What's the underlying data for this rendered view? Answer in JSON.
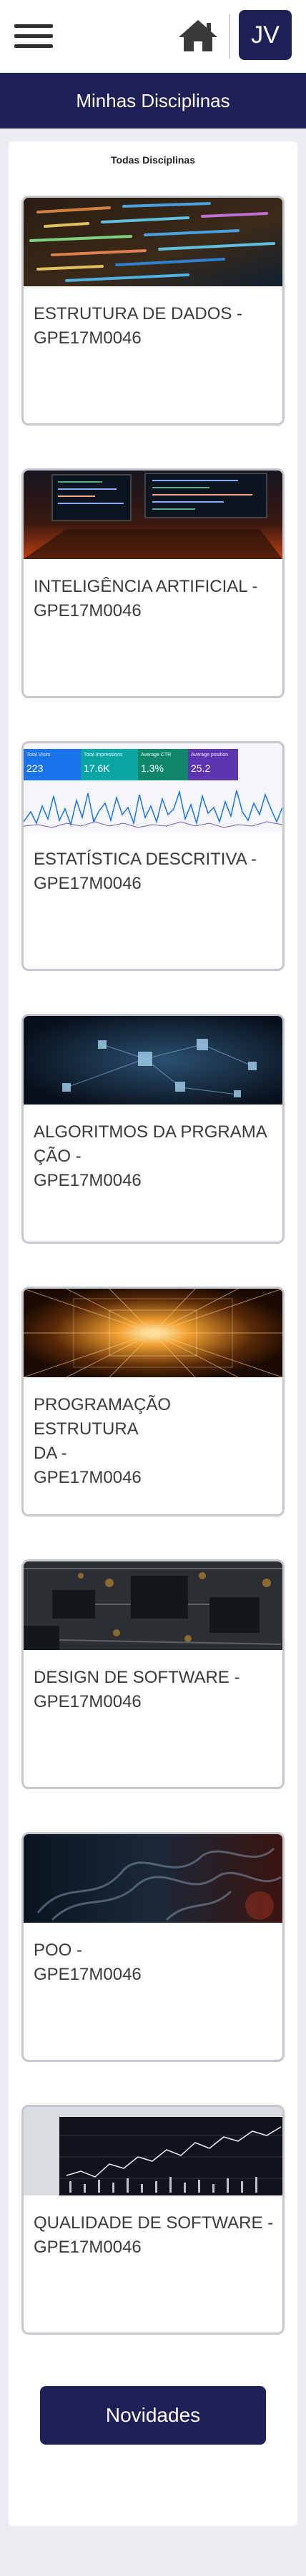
{
  "header": {
    "menu_icon": "hamburger-menu-icon",
    "home_icon": "home-icon",
    "avatar_initials": "JV"
  },
  "page": {
    "title": "Minhas Disciplinas",
    "section_title": "Todas Disciplinas"
  },
  "courses": [
    {
      "title": "ESTRUTURA DE DADOS -\nGPE17M0046",
      "image": "code-screen-image"
    },
    {
      "title": "INTELIGÊNCIA ARTIFICIAL -\nGPE17M0046",
      "image": "laptop-code-image"
    },
    {
      "title": "ESTATÍSTICA DESCRITIVA -\nGPE17M0046",
      "image": "analytics-dashboard-image",
      "image_stats": [
        {
          "label": "Total Visits",
          "value": "223"
        },
        {
          "label": "Total Impressions",
          "value": "17.6K"
        },
        {
          "label": "Average CTR",
          "value": "1.3%"
        },
        {
          "label": "Average position",
          "value": "25.2"
        }
      ]
    },
    {
      "title": "ALGORITMOS DA PRGRAMA\nÇÃO -\nGPE17M0046",
      "image": "network-cubes-image"
    },
    {
      "title": "PROGRAMAÇÃO ESTRUTURA\nDA -\nGPE17M0046",
      "image": "data-tunnel-image"
    },
    {
      "title": "DESIGN DE SOFTWARE -\nGPE17M0046",
      "image": "circuit-board-image"
    },
    {
      "title": "POO -\nGPE17M0046",
      "image": "smoke-dark-image"
    },
    {
      "title": "QUALIDADE DE SOFTWARE -\nGPE17M0046",
      "image": "stock-chart-image"
    }
  ],
  "footer": {
    "news_button": "Novidades"
  },
  "colors": {
    "brand": "#1e2057",
    "background": "#ebebf2",
    "card_border": "#c6c6cf"
  }
}
